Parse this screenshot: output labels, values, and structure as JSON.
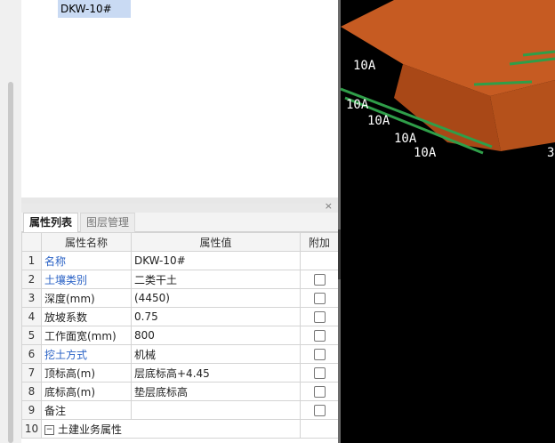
{
  "tree": {
    "selected_item": "DKW-10#"
  },
  "tabs": {
    "properties": "属性列表",
    "layers": "图层管理"
  },
  "panel": {
    "close_glyph": "×"
  },
  "table": {
    "headers": {
      "name": "属性名称",
      "value": "属性值",
      "extra": "附加"
    },
    "rows": [
      {
        "idx": "1",
        "name": "名称",
        "value": "DKW-10#",
        "blue": true,
        "checkbox": false
      },
      {
        "idx": "2",
        "name": "土壤类别",
        "value": "二类干土",
        "blue": true,
        "checkbox": true
      },
      {
        "idx": "3",
        "name": "深度(mm)",
        "value": "(4450)",
        "blue": false,
        "checkbox": true
      },
      {
        "idx": "4",
        "name": "放坡系数",
        "value": "0.75",
        "blue": false,
        "checkbox": true
      },
      {
        "idx": "5",
        "name": "工作面宽(mm)",
        "value": "800",
        "blue": false,
        "checkbox": true
      },
      {
        "idx": "6",
        "name": "挖土方式",
        "value": "机械",
        "blue": true,
        "checkbox": true
      },
      {
        "idx": "7",
        "name": "顶标高(m)",
        "value": "层底标高+4.45",
        "blue": false,
        "checkbox": true
      },
      {
        "idx": "8",
        "name": "底标高(m)",
        "value": "垫层底标高",
        "blue": false,
        "checkbox": true
      },
      {
        "idx": "9",
        "name": "备注",
        "value": "",
        "blue": false,
        "checkbox": true
      },
      {
        "idx": "10",
        "name": "土建业务属性",
        "value": "",
        "blue": false,
        "checkbox": false,
        "group": true
      }
    ]
  },
  "viewport": {
    "labels": [
      "10A",
      "10A",
      "10A",
      "10A",
      "10A",
      "3"
    ],
    "colors": {
      "slab_top": "#c65b22",
      "slab_side": "#a94817",
      "rebar": "#2f9e49",
      "text": "#ffffff"
    }
  }
}
